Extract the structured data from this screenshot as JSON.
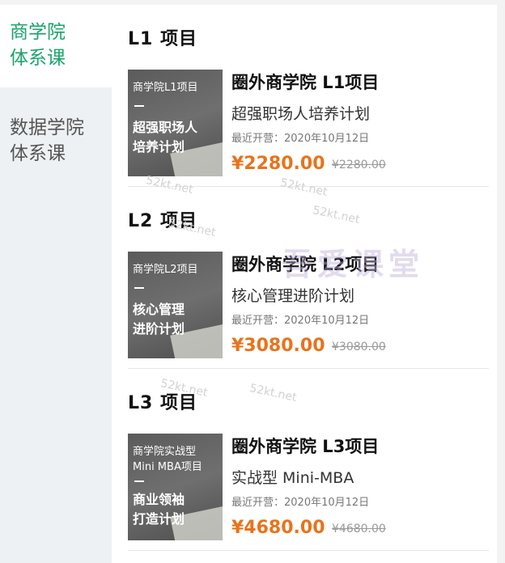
{
  "sidebar": {
    "items": [
      {
        "label_line1": "商学院",
        "label_line2": "体系课"
      },
      {
        "label_line1": "数据学院",
        "label_line2": "体系课"
      }
    ]
  },
  "sections": [
    {
      "title": "L1 项目",
      "course": {
        "thumb_line1": "商学院L1项目",
        "thumb_line2": "",
        "thumb_bold1": "超强职场人",
        "thumb_bold2": "培养计划",
        "title": "圈外商学院 L1项目",
        "subtitle": "超强职场人培养计划",
        "date": "最近开营：2020年10月12日",
        "price": "¥2280.00",
        "original_price": "¥2280.00"
      }
    },
    {
      "title": "L2 项目",
      "course": {
        "thumb_line1": "商学院L2项目",
        "thumb_line2": "",
        "thumb_bold1": "核心管理",
        "thumb_bold2": "进阶计划",
        "title": "圈外商学院 L2项目",
        "subtitle": "核心管理进阶计划",
        "date": "最近开营：2020年10月12日",
        "price": "¥3080.00",
        "original_price": "¥3080.00"
      }
    },
    {
      "title": "L3 项目",
      "course": {
        "thumb_line1": "商学院实战型",
        "thumb_line2": "Mini MBA项目",
        "thumb_bold1": "商业领袖",
        "thumb_bold2": "打造计划",
        "title": "圈外商学院 L3项目",
        "subtitle": "实战型 Mini-MBA",
        "date": "最近开营：2020年10月12日",
        "price": "¥4680.00",
        "original_price": "¥4680.00"
      }
    }
  ],
  "watermarks": {
    "small": "52kt.net",
    "big": "吾爱课堂"
  },
  "colors": {
    "accent_green": "#1aa46b",
    "price_orange": "#e8731c",
    "sidebar_bg": "#eef1f4"
  }
}
